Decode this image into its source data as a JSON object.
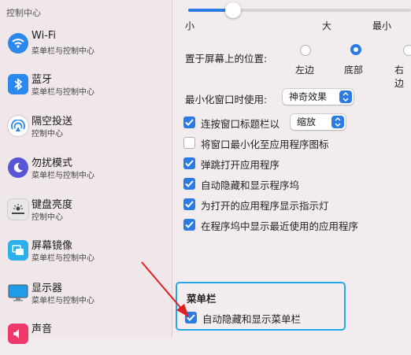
{
  "sidebar": {
    "header": "控制中心",
    "items": [
      {
        "title": "Wi-Fi",
        "sub": "菜单栏与控制中心",
        "icon": "wifi-icon"
      },
      {
        "title": "蓝牙",
        "sub": "菜单栏与控制中心",
        "icon": "bluetooth-icon"
      },
      {
        "title": "隔空投送",
        "sub": "控制中心",
        "icon": "airdrop-icon"
      },
      {
        "title": "勿扰模式",
        "sub": "菜单栏与控制中心",
        "icon": "moon-icon"
      },
      {
        "title": "键盘亮度",
        "sub": "控制中心",
        "icon": "keyboard-brightness-icon"
      },
      {
        "title": "屏幕镜像",
        "sub": "菜单栏与控制中心",
        "icon": "screen-mirroring-icon"
      },
      {
        "title": "显示器",
        "sub": "菜单栏与控制中心",
        "icon": "display-icon"
      },
      {
        "title": "声音",
        "sub": "",
        "icon": "sound-icon"
      }
    ]
  },
  "dock": {
    "size_slider": {
      "min_label": "小",
      "max_label": "大",
      "value": 0.2
    },
    "magnify_min_label": "最小",
    "magnify_max_label": "",
    "position": {
      "label": "置于屏幕上的位置:",
      "options": [
        "左边",
        "底部",
        "右边"
      ],
      "selected": "底部"
    },
    "minimize": {
      "label": "最小化窗口时使用:",
      "value": "神奇效果"
    },
    "double_click": {
      "label": "连按窗口标题栏以",
      "value": "缩放",
      "checked": true
    },
    "checkboxes": [
      {
        "label": "将窗口最小化至应用程序图标",
        "checked": false
      },
      {
        "label": "弹跳打开应用程序",
        "checked": true
      },
      {
        "label": "自动隐藏和显示程序坞",
        "checked": true
      },
      {
        "label": "为打开的应用程序显示指示灯",
        "checked": true
      },
      {
        "label": "在程序坞中显示最近使用的应用程序",
        "checked": true
      }
    ]
  },
  "menubar": {
    "title": "菜单栏",
    "auto_hide": {
      "label": "自动隐藏和显示菜单栏",
      "checked": true
    }
  },
  "colors": {
    "accent": "#2a7be4",
    "highlight_box": "#25a8e6",
    "arrow": "#e02020"
  }
}
